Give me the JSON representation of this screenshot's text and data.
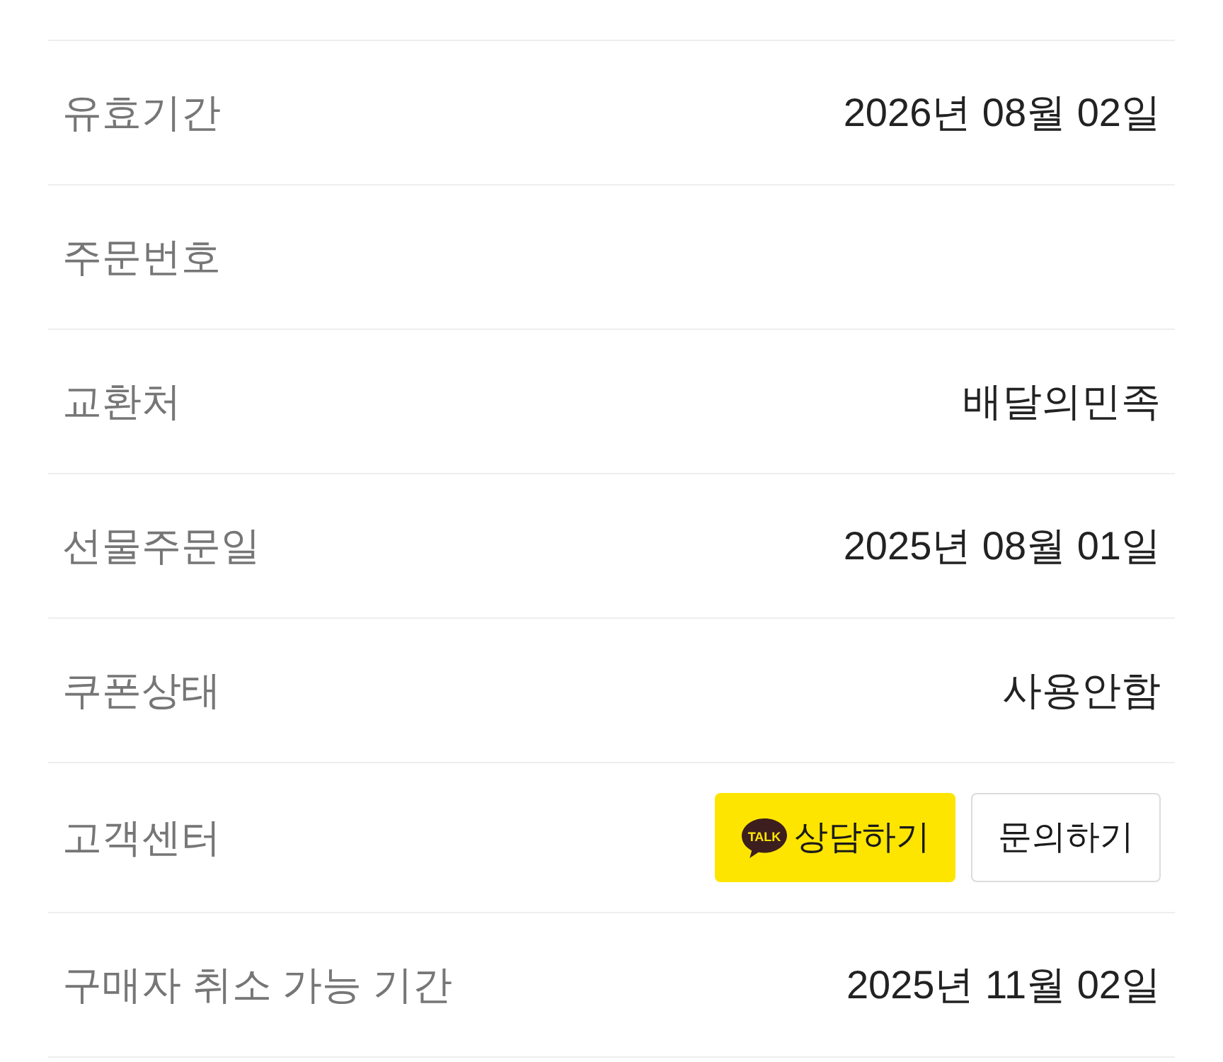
{
  "rows": [
    {
      "label": "유효기간",
      "kind": "text",
      "value": "2026년 08월 02일"
    },
    {
      "label": "주문번호",
      "kind": "text"
    },
    {
      "label": "교환처",
      "kind": "text",
      "value": "배달의민족"
    },
    {
      "label": "선물주문일",
      "kind": "text",
      "value": "2025년 08월 01일"
    },
    {
      "label": "쿠폰상태",
      "kind": "text",
      "value": "사용안함"
    },
    {
      "label": "고객센터",
      "kind": "buttons",
      "buttons": [
        {
          "label": "상담하기",
          "kind": "kakao",
          "icon_text": "TALK"
        },
        {
          "label": "문의하기",
          "kind": "outline"
        }
      ]
    },
    {
      "label": "구매자 취소 가능 기간",
      "kind": "text",
      "value": "2025년 11월 02일"
    }
  ]
}
